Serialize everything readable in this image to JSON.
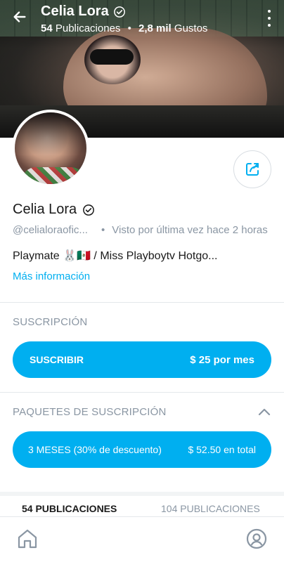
{
  "header": {
    "name": "Celia Lora",
    "posts_count": "54",
    "posts_label": "Publicaciones",
    "likes_count": "2,8 mil",
    "likes_label": "Gustos"
  },
  "profile": {
    "name": "Celia Lora",
    "handle": "@celialoraofic...",
    "last_seen": "Visto por última vez hace 2 horas",
    "bio": "Playmate 🐰🇲🇽 / Miss Playboytv Hotgo...",
    "more_info": "Más información"
  },
  "subscription": {
    "title": "SUSCRIPCIÓN",
    "button_label": "SUSCRIBIR",
    "button_price": "$ 25 por mes"
  },
  "bundles": {
    "title": "PAQUETES DE SUSCRIPCIÓN",
    "bundle_label": "3 MESES (30% de descuento)",
    "bundle_price": "$ 52.50 en total"
  },
  "tabs": {
    "posts": "54 PUBLICACIONES",
    "media": "104 PUBLICACIONES"
  },
  "colors": {
    "accent": "#00aff0",
    "muted": "#8a96a3"
  }
}
